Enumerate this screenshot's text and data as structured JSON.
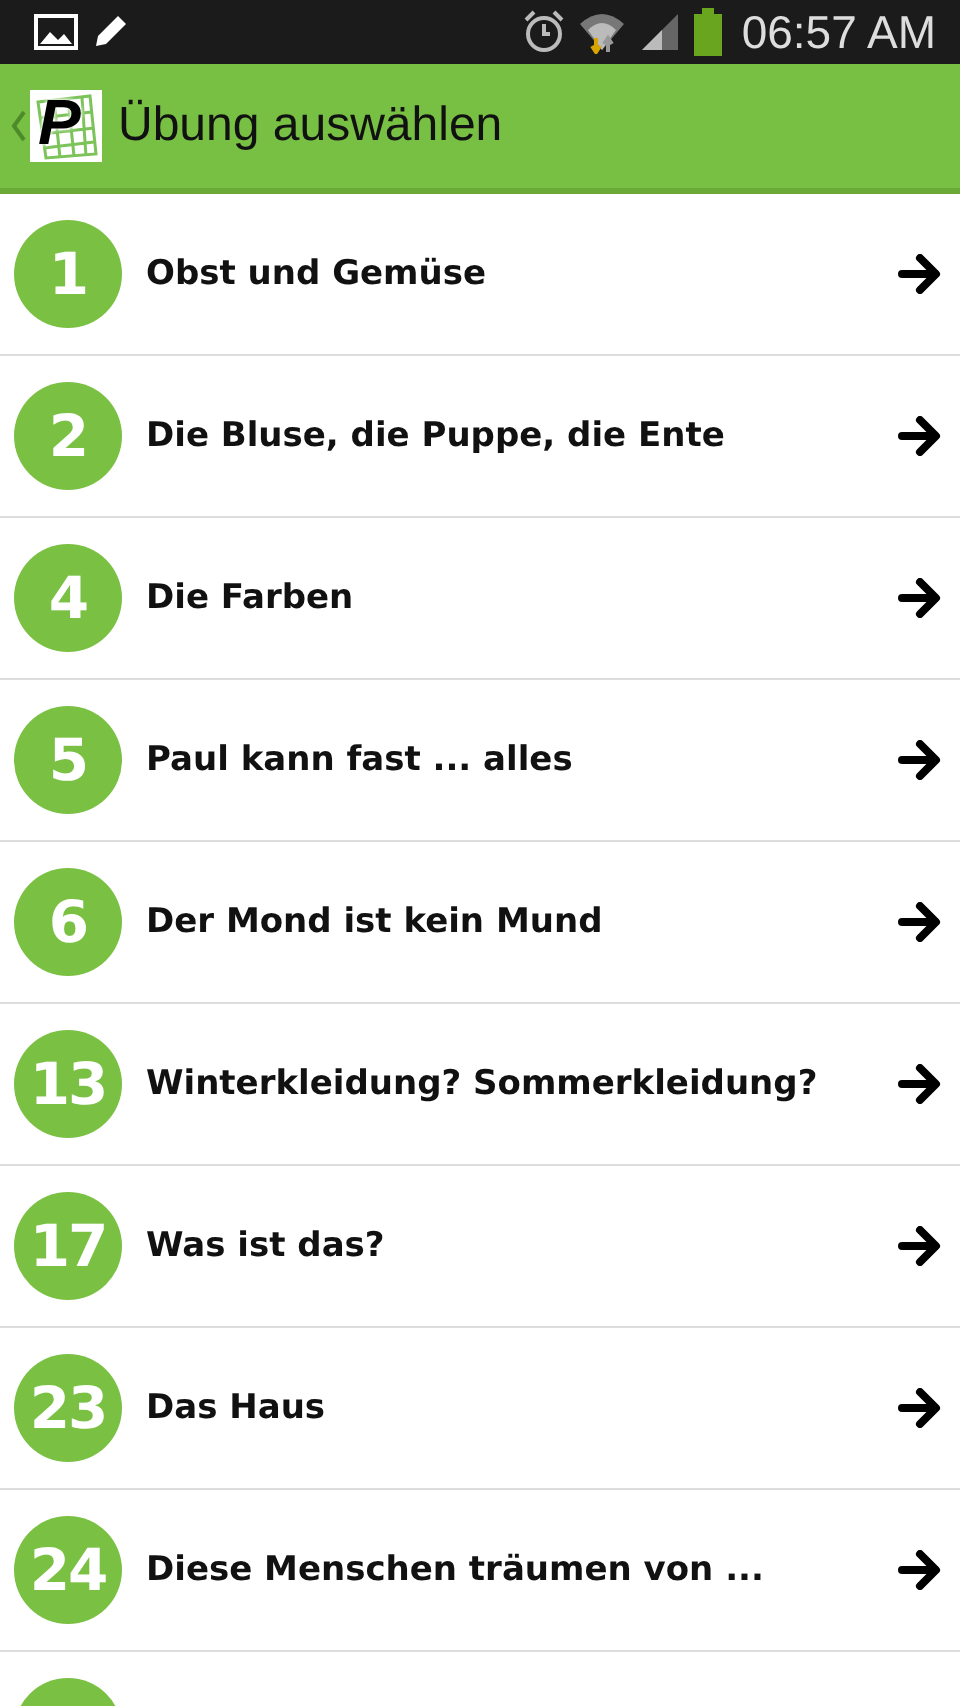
{
  "status_bar": {
    "time": "06:57 AM"
  },
  "action_bar": {
    "logo_letter": "P",
    "title": "Übung auswählen"
  },
  "exercises": [
    {
      "number": "1",
      "title": "Obst und Gemüse"
    },
    {
      "number": "2",
      "title": "Die Bluse, die Puppe, die Ente"
    },
    {
      "number": "4",
      "title": "Die Farben"
    },
    {
      "number": "5",
      "title": "Paul kann fast ... alles"
    },
    {
      "number": "6",
      "title": "Der Mond ist kein Mund"
    },
    {
      "number": "13",
      "title": "Winterkleidung? Sommerkleidung?"
    },
    {
      "number": "17",
      "title": "Was ist das?"
    },
    {
      "number": "23",
      "title": "Das Haus"
    },
    {
      "number": "24",
      "title": "Diese Menschen träumen von ..."
    }
  ],
  "more_below": true
}
